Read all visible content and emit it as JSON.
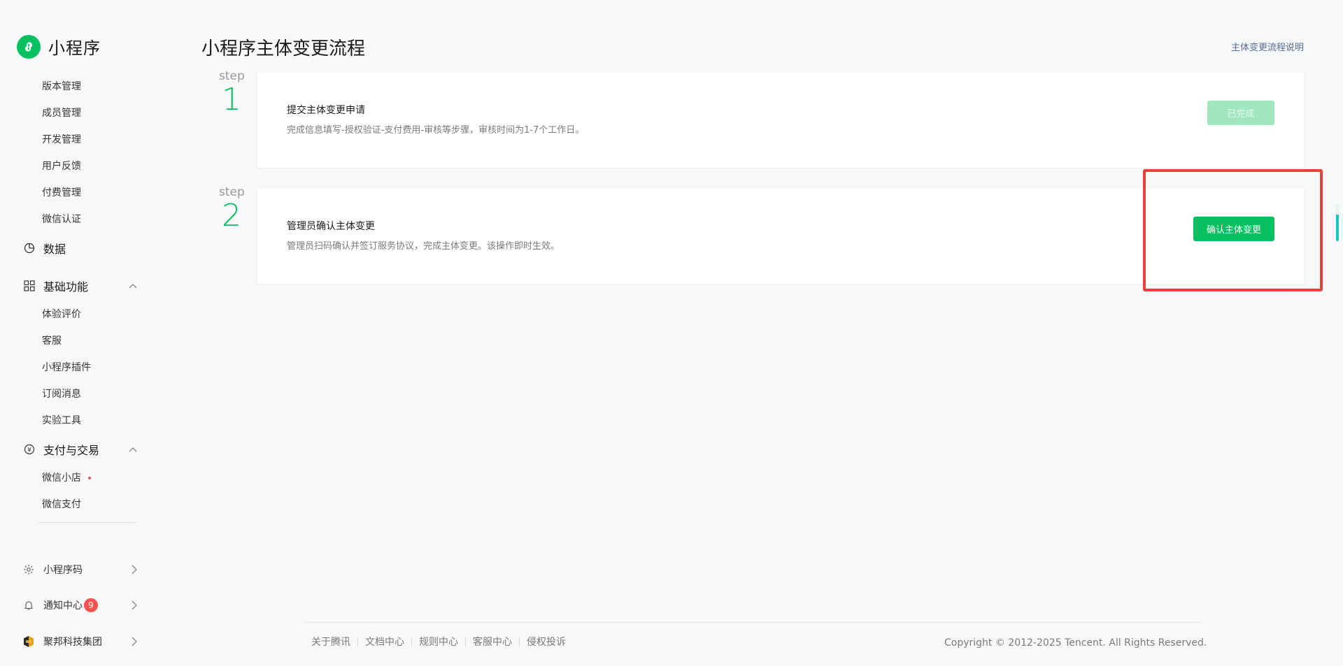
{
  "app": {
    "name": "小程序"
  },
  "sidebar": {
    "top_items": [
      "版本管理",
      "成员管理",
      "开发管理",
      "用户反馈",
      "付费管理",
      "微信认证"
    ],
    "data_label": "数据",
    "basic_group": {
      "label": "基础功能",
      "items": [
        "体验评价",
        "客服",
        "小程序插件",
        "订阅消息",
        "实验工具"
      ]
    },
    "pay_group": {
      "label": "支付与交易",
      "items": [
        "微信小店",
        "微信支付"
      ]
    },
    "bottom": {
      "qrcode_label": "小程序码",
      "notify_label": "通知中心",
      "notify_count": "9",
      "account_label": "聚邦科技集团"
    }
  },
  "main": {
    "title": "小程序主体变更流程",
    "help_link": "主体变更流程说明",
    "steps": [
      {
        "step_word": "step",
        "number": "1",
        "title": "提交主体变更申请",
        "desc": "完成信息填写-授权验证-支付费用-审核等步骤，审核时间为1-7个工作日。",
        "button": "已完成"
      },
      {
        "step_word": "step",
        "number": "2",
        "title": "管理员确认主体变更",
        "desc": "管理员扫码确认并签订服务协议，完成主体变更。该操作即时生效。",
        "button": "确认主体变更"
      }
    ]
  },
  "footer": {
    "links": [
      "关于腾讯",
      "文档中心",
      "规则中心",
      "客服中心",
      "侵权投诉"
    ],
    "copyright": "Copyright © 2012-2025 Tencent. All Rights Reserved."
  },
  "colors": {
    "accent": "#07c160",
    "link": "#576b95",
    "badge": "#fa5151",
    "highlight": "#e8413a"
  }
}
